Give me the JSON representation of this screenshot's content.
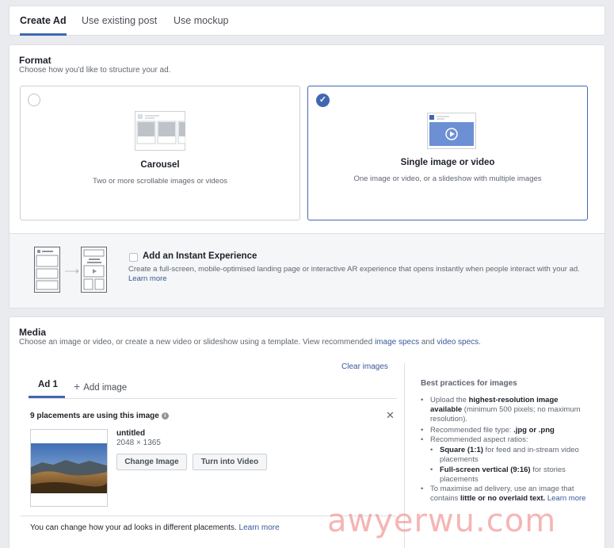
{
  "tabs": [
    {
      "label": "Create Ad",
      "active": true
    },
    {
      "label": "Use existing post",
      "active": false
    },
    {
      "label": "Use mockup",
      "active": false
    }
  ],
  "format": {
    "title": "Format",
    "subtitle": "Choose how you'd like to structure your ad.",
    "options": [
      {
        "title": "Carousel",
        "desc": "Two or more scrollable images or videos",
        "selected": false
      },
      {
        "title": "Single image or video",
        "desc": "One image or video, or a slideshow with multiple images",
        "selected": true
      }
    ],
    "instant_experience": {
      "title": "Add an Instant Experience",
      "desc": "Create a full-screen, mobile-optimised landing page or interactive AR experience that opens instantly when people interact with your ad.",
      "link": "Learn more",
      "checked": false
    }
  },
  "media": {
    "title": "Media",
    "subtitle_a": "Choose an image or video, or create a new video or slideshow using a template. View recommended",
    "image_specs": "image specs",
    "and": "and",
    "video_specs": "video specs",
    "period": ".",
    "clear_images": "Clear images",
    "ad_tab": "Ad 1",
    "add_image": "Add image",
    "placements": "9 placements are using this image",
    "file_name": "untitled",
    "file_dims": "2048 × 1365",
    "change_image": "Change Image",
    "turn_into_video": "Turn into Video",
    "note": "You can change how your ad looks in different placements.",
    "note_link": "Learn more"
  },
  "best_practices": {
    "title": "Best practices for images",
    "b1_a": "Upload the",
    "b1_b": "highest-resolution image available",
    "b1_c": "(minimum 500 pixels; no maximum resolution).",
    "b2_a": "Recommended file type:",
    "b2_b": ".jpg or .png",
    "b3": "Recommended aspect ratios:",
    "s1_a": "Square (1:1)",
    "s1_b": "for feed and in-stream video placements",
    "s2_a": "Full-screen vertical (9:16)",
    "s2_b": "for stories placements",
    "b4_a": "To maximise ad delivery, use an image that contains",
    "b4_b": "little or no overlaid text.",
    "b4_link": "Learn more"
  },
  "watermark": "awyerwu.com",
  "colors": {
    "accent": "#4267b2",
    "link": "#385898",
    "bg": "#e9ebee"
  }
}
